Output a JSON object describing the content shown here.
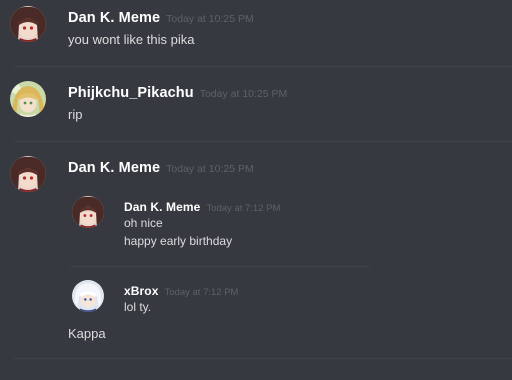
{
  "messages": [
    {
      "author": "Dan K. Meme",
      "timestamp": "Today at 10:25 PM",
      "text": "you wont like this pika",
      "avatar_icon": "anime-girl-avatar"
    },
    {
      "author": "Phijkchu_Pikachu",
      "timestamp": "Today at 10:25 PM",
      "text": "rip",
      "avatar_icon": "blonde-character-avatar"
    },
    {
      "author": "Dan K. Meme",
      "timestamp": "Today at 10:25 PM",
      "avatar_icon": "anime-girl-avatar",
      "quotes": [
        {
          "author": "Dan K. Meme",
          "timestamp": "Today at 7:12 PM",
          "lines": [
            "oh nice",
            "happy early birthday"
          ],
          "avatar_icon": "anime-girl-avatar"
        },
        {
          "author": "xBrox",
          "timestamp": "Today at 7:12 PM",
          "lines": [
            "lol ty."
          ],
          "avatar_icon": "white-hair-character-avatar"
        }
      ],
      "text": "Kappa"
    }
  ],
  "colors": {
    "background": "#36393f",
    "username": "#ffffff",
    "timestamp": "#5e6168",
    "text": "#dcddde",
    "divider": "#40434a"
  }
}
